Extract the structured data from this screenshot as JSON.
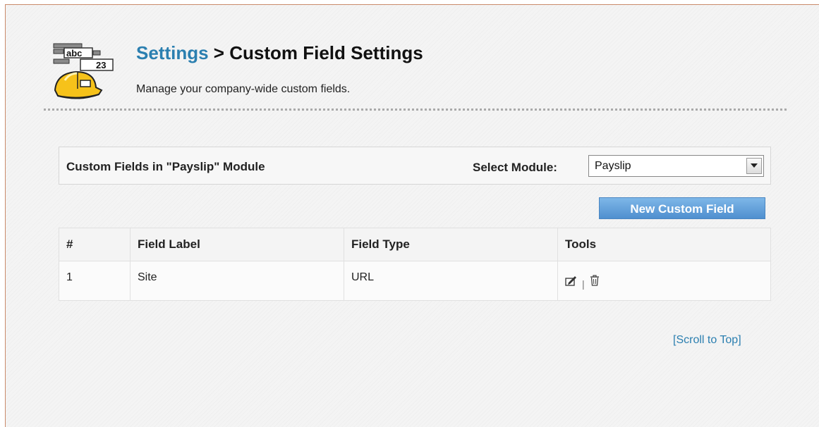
{
  "header": {
    "breadcrumb_link": "Settings",
    "breadcrumb_sep": " > ",
    "page_title": "Custom Field Settings",
    "subtitle": "Manage your company-wide custom fields.",
    "icon": "custom-fields-hardhat-icon"
  },
  "module_bar": {
    "title": "Custom Fields in \"Payslip\" Module",
    "select_label": "Select Module:",
    "selected_module": "Payslip"
  },
  "actions": {
    "new_custom_field": "New Custom Field"
  },
  "table": {
    "columns": [
      "#",
      "Field Label",
      "Field Type",
      "Tools"
    ],
    "rows": [
      {
        "num": "1",
        "label": "Site",
        "type": "URL",
        "tools": [
          "edit-icon",
          "delete-icon"
        ],
        "tool_separator": "|"
      }
    ]
  },
  "footer": {
    "scroll_to_top": "[Scroll to Top]"
  },
  "colors": {
    "link": "#2b7fb0",
    "button": "#5b98d4",
    "frame_border": "#c98a6a"
  }
}
